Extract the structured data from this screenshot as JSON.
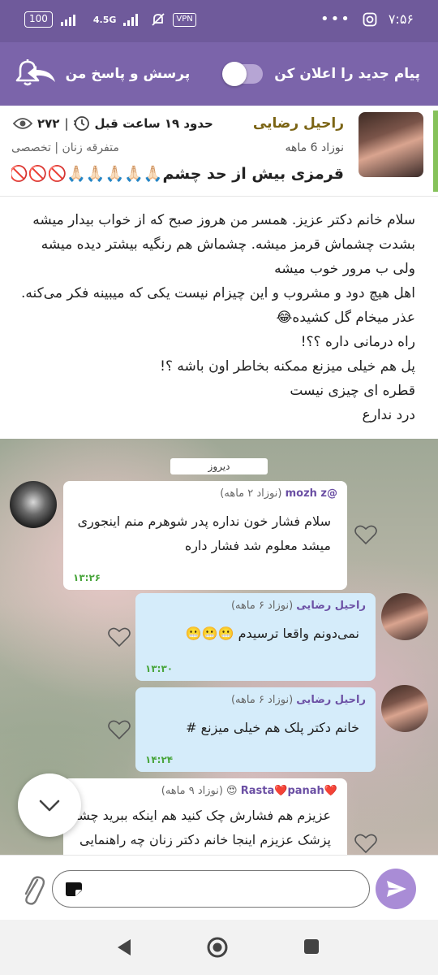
{
  "status_bar": {
    "battery": "100",
    "network": "4.5G",
    "vpn": "VPN",
    "time": "۷:۵۶",
    "more": "•••"
  },
  "header": {
    "announce_label": "پیام جدید را اعلان کن",
    "qa_label": "پرسش و پاسخ من"
  },
  "post": {
    "author": "راحیل رضایی",
    "baby_age": "نوزاد 6 ماهه",
    "time_ago": "حدود ۱۹ ساعت قبل",
    "views": "۲۷۲",
    "category": "متفرقه زنان | تخصصی",
    "title": "قرمزی بیش از حد چشم🙏🏻🙏🏻🙏🏻🙏🏻🙏🏻🚫🚫🚫🚫",
    "body": [
      "سلام خانم دکتر عزیز. همسر من هروز صبح که از خواب بیدار میشه",
      "بشدت چشماش قرمز میشه. چشماش هم رنگیه  بیشتر دیده میشه",
      "ولی ب مرور خوب میشه",
      "اهل هیچ دود و مشروب و این چیزام نیست یکی که میبینه فکر می‌کنه.",
      "عذر میخام گل کشیده😂",
      "راه درمانی داره ؟؟!",
      "پل هم خیلی میزنع ممکنه بخاطر اون باشه ؟!",
      "قطره ای چیزی نیست",
      "درد ندارع"
    ]
  },
  "chat": {
    "date_chip": "دیروز",
    "messages": [
      {
        "author": "@mozh z",
        "meta": "(نوزاد ۲ ماهه)",
        "lines": [
          "سلام فشار خون نداره پدر شوهرم منم اینجوری",
          "میشد معلوم شد فشار داره"
        ],
        "time": "۱۳:۲۶"
      },
      {
        "author": "راحیل رضایی",
        "meta": "(نوزاد ۶ ماهه)",
        "lines": [
          "نمی‌دونم واقعا ترسیدم 😬😬😬"
        ],
        "time": "۱۳:۳۰"
      },
      {
        "author": "راحیل رضایی",
        "meta": "(نوزاد ۶ ماهه)",
        "lines": [
          "خانم دکتر پلک هم خیلی میزنع #"
        ],
        "time": "۱۴:۲۴"
      },
      {
        "author": "❤️Rasta❤️panah",
        "meta": "😍 (نوزاد ۹ ماهه)",
        "lines": [
          "عزیزم هم فشارش چک کنید هم اینکه ببرید چشم",
          "پزشک عزیزم اینجا خانم دکتر زنان چه راهنمایی"
        ],
        "time": ""
      }
    ]
  },
  "icons": {
    "bell": "bell-icon",
    "reply": "reply-arrow-icon",
    "eye": "eye-icon",
    "clock": "clock-icon",
    "heart": "heart-outline-icon",
    "chevron": "chevron-down-icon",
    "attach": "paperclip-icon",
    "send": "send-icon"
  },
  "colors": {
    "header": "#7b64aa",
    "status_bar": "#6f5a9b",
    "accent_green": "#86c25a",
    "author_gold": "#7b6414",
    "outgoing_bubble": "#d5ecfa",
    "send_button": "#a98cd6"
  }
}
